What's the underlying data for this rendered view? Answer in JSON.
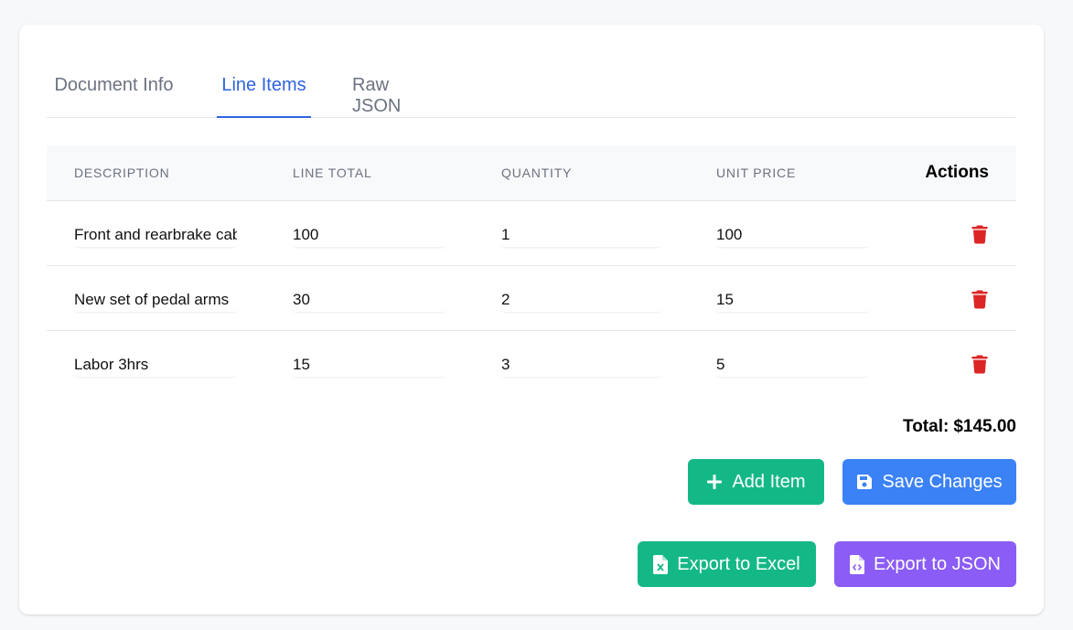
{
  "tabs": [
    {
      "label": "Document Info",
      "active": false
    },
    {
      "label": "Line Items",
      "active": true
    },
    {
      "label": "Raw JSON",
      "active": false
    }
  ],
  "table": {
    "headers": {
      "description": "DESCRIPTION",
      "line_total": "LINE TOTAL",
      "quantity": "QUANTITY",
      "unit_price": "UNIT PRICE",
      "actions": "Actions"
    },
    "rows": [
      {
        "description": "Front and rearbrake cables",
        "line_total": "100",
        "quantity": "1",
        "unit_price": "100"
      },
      {
        "description": "New set of pedal arms",
        "line_total": "30",
        "quantity": "2",
        "unit_price": "15"
      },
      {
        "description": "Labor 3hrs",
        "line_total": "15",
        "quantity": "3",
        "unit_price": "5"
      }
    ]
  },
  "total": {
    "label": "Total:",
    "value": "$145.00"
  },
  "buttons": {
    "add_item": "Add Item",
    "save_changes": "Save Changes",
    "export_excel": "Export to Excel",
    "export_json": "Export to JSON"
  },
  "icons": {
    "delete": "trash-icon",
    "add": "plus-icon",
    "save": "floppy-disk-icon",
    "excel": "file-excel-icon",
    "json": "file-code-icon"
  },
  "colors": {
    "accent": "#2f63e0",
    "green": "#14b886",
    "blue": "#3b82f6",
    "purple": "#8b5cf6",
    "danger": "#dc2626"
  }
}
